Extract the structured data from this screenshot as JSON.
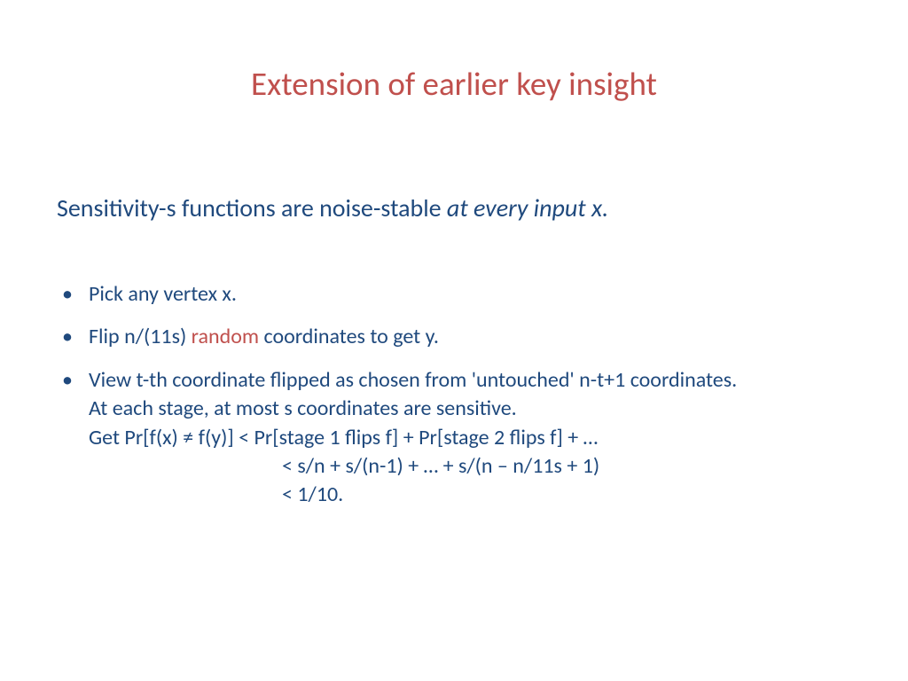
{
  "title": "Extension of earlier key insight",
  "subtitle_prefix": "Sensitivity-s functions are noise-stable ",
  "subtitle_italic": "at every input x.",
  "bullets": {
    "b1": "Pick any vertex x.",
    "b2_prefix": "Flip n/(11s) ",
    "b2_red": "random",
    "b2_suffix": " coordinates to get y.",
    "b3_line1": "View t-th coordinate flipped as chosen from 'untouched' n-t+1 coordinates.",
    "b3_line2": "At each stage, at most s coordinates are sensitive.",
    "b3_line3": "Get  Pr[f(x) ≠ f(y)] < Pr[stage 1 flips f] + Pr[stage 2 flips f] + …",
    "b3_line4": "< s/n + s/(n-1) + … + s/(n – n/11s + 1)",
    "b3_line5": "< 1/10."
  }
}
